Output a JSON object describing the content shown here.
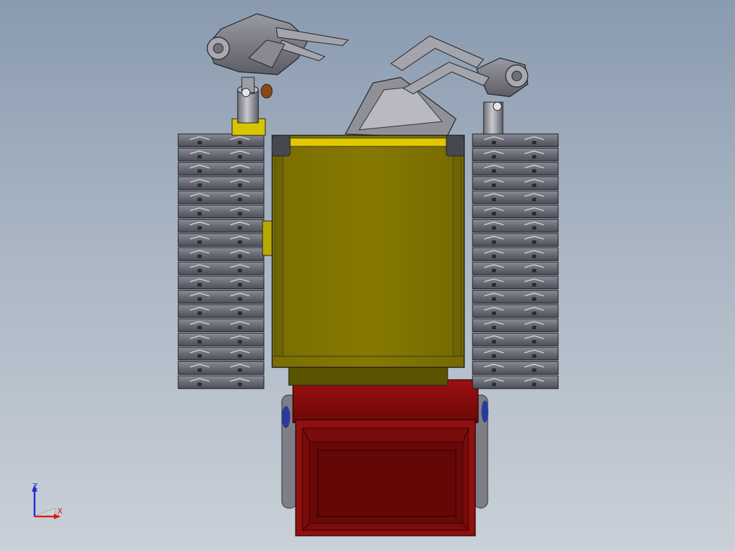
{
  "triad": {
    "z_label": "Z",
    "x_label": "X",
    "z_color": "#1e2fd6",
    "x_color": "#d61e1e"
  },
  "model": {
    "name": "robot-assembly-top-view",
    "colors": {
      "background_top": "#8a9bb0",
      "background_bottom": "#c9d0d8",
      "body_yellow": "#7f7300",
      "body_yellow_light": "#d9c400",
      "track_gray": "#6e6f78",
      "arm_gray": "#8e8e96",
      "base_red": "#8a0e0e",
      "base_red_dark": "#6a0707"
    }
  }
}
